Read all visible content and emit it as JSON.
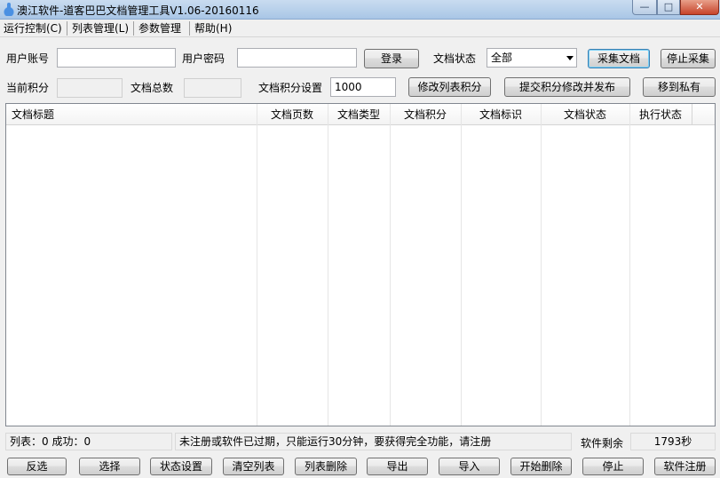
{
  "window": {
    "title": "澳江软件-道客巴巴文档管理工具V1.06-20160116",
    "min_glyph": "—",
    "max_glyph": "□",
    "close_glyph": "✕"
  },
  "menu": {
    "items": [
      {
        "label": "运行控制(C)"
      },
      {
        "label": "列表管理(L)"
      },
      {
        "label": "参数管理"
      },
      {
        "label": "帮助(H)"
      }
    ]
  },
  "form": {
    "account_label": "用户账号",
    "account_value": "",
    "password_label": "用户密码",
    "password_value": "",
    "login_button": "登录",
    "doc_status_label": "文档状态",
    "doc_status_value": "全部",
    "collect_button": "采集文档",
    "stop_collect_button": "停止采集",
    "current_points_label": "当前积分",
    "current_points_value": "",
    "doc_total_label": "文档总数",
    "doc_total_value": "",
    "points_setting_label": "文档积分设置",
    "points_setting_value": "1000",
    "modify_points_button": "修改列表积分",
    "submit_points_button": "提交积分修改并发布",
    "move_private_button": "移到私有"
  },
  "table": {
    "columns": [
      "文档标题",
      "文档页数",
      "文档类型",
      "文档积分",
      "文档标识",
      "文档状态",
      "执行状态"
    ],
    "rows": []
  },
  "status": {
    "list_info": "列表：0 成功：0",
    "message": "未注册或软件已过期，只能运行30分钟，要获得完全功能，请注册",
    "remaining_label": "软件剩余",
    "remaining_value": "1793秒"
  },
  "bottom_buttons": {
    "invert": "反选",
    "select": "选择",
    "status_setting": "状态设置",
    "clear_list": "清空列表",
    "list_delete": "列表删除",
    "export": "导出",
    "import": "导入",
    "start_delete": "开始删除",
    "stop": "停止",
    "register": "软件注册"
  }
}
